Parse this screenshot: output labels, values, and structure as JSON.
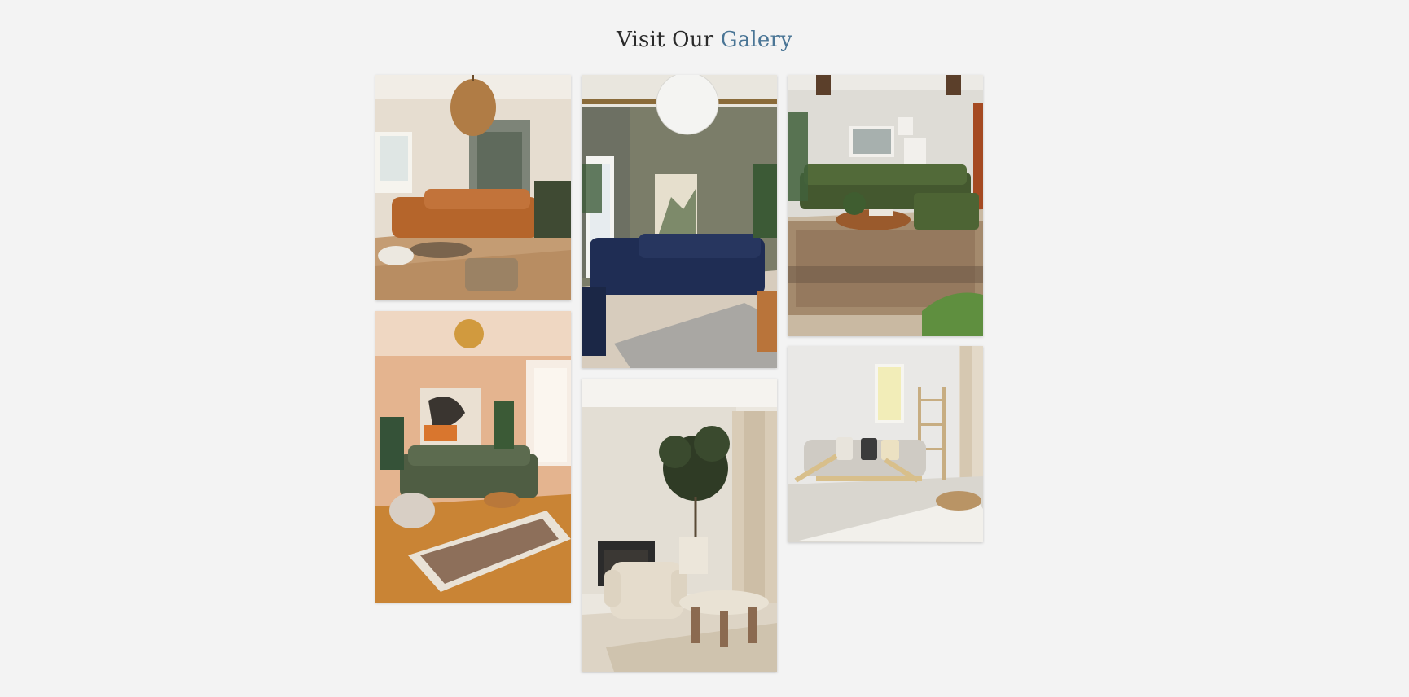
{
  "header": {
    "title_prefix": "Visit Our",
    "title_accent": "Galery"
  },
  "colors": {
    "background": "#f3f3f3",
    "title": "#2a2a2a",
    "accent": "#4a7595"
  },
  "gallery": {
    "images": [
      {
        "name": "living-room-tan-sofa-photo",
        "alt": ""
      },
      {
        "name": "living-room-green-sofa-warm-photo",
        "alt": ""
      },
      {
        "name": "living-room-navy-sofa-photo",
        "alt": ""
      },
      {
        "name": "living-room-cream-armchair-photo",
        "alt": ""
      },
      {
        "name": "living-room-green-sectional-photo",
        "alt": ""
      },
      {
        "name": "living-room-wooden-futon-photo",
        "alt": ""
      }
    ]
  }
}
